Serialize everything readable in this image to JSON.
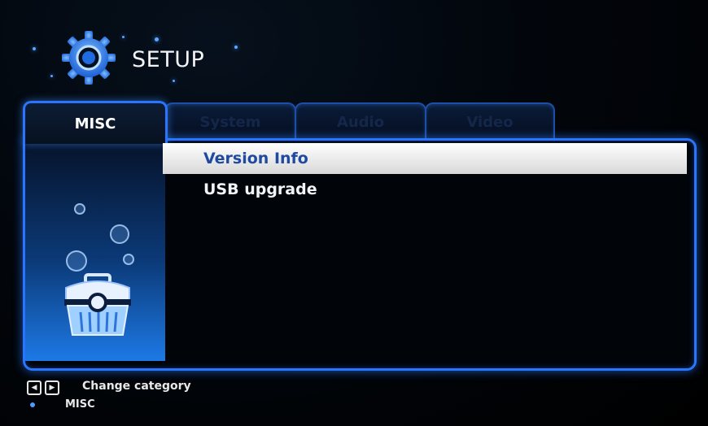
{
  "header": {
    "title": "SETUP",
    "icon": "gear-icon"
  },
  "tabs": [
    {
      "label": "MISC",
      "active": true
    },
    {
      "label": "System",
      "active": false
    },
    {
      "label": "Audio",
      "active": false
    },
    {
      "label": "Video",
      "active": false
    }
  ],
  "category_panel": {
    "icon": "toolbox-icon"
  },
  "menu": {
    "items": [
      {
        "label": "Version Info",
        "selected": true
      },
      {
        "label": "USB upgrade",
        "selected": false
      }
    ]
  },
  "footer": {
    "hint": "Change category",
    "current_category": "MISC",
    "left_key_icon": "left-arrow-key-icon",
    "right_key_icon": "right-arrow-key-icon"
  },
  "colors": {
    "accent": "#2a75ff",
    "selection_bg": "#f0f0f0",
    "selection_text": "#1f4aa0",
    "text": "#f2f4f8"
  }
}
